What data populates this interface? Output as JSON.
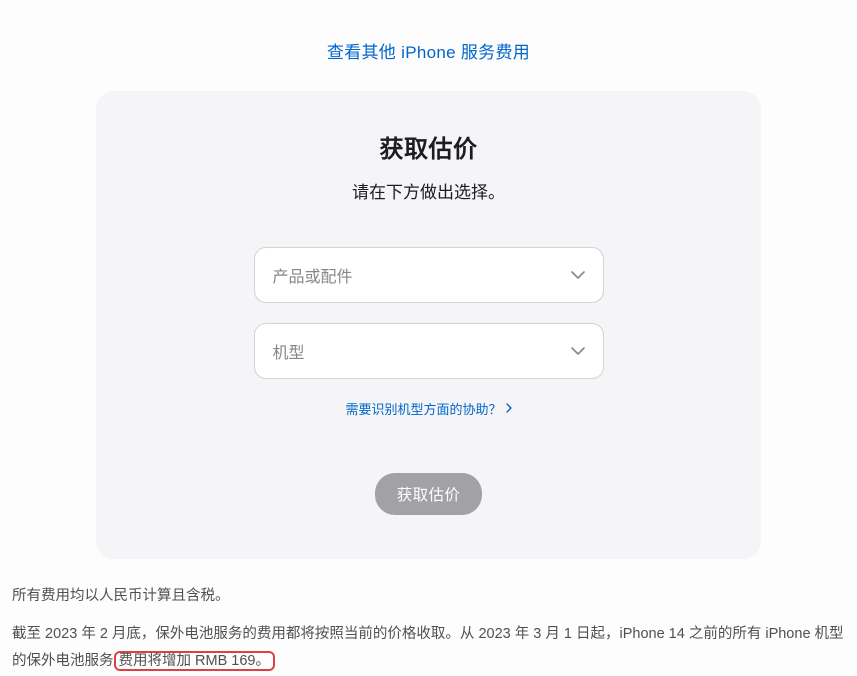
{
  "top_link": "查看其他 iPhone 服务费用",
  "card": {
    "title": "获取估价",
    "subtitle": "请在下方做出选择。",
    "dropdown1_placeholder": "产品或配件",
    "dropdown2_placeholder": "机型",
    "help_link": "需要识别机型方面的协助？",
    "submit_label": "获取估价"
  },
  "footnotes": {
    "line1": "所有费用均以人民币计算且含税。",
    "line2_part1": "截至 2023 年 2 月底，保外电池服务的费用都将按照当前的价格收取。从 2023 年 3 月 1 日起，iPhone 14 之前的所有 iPhone 机型的保外电池服务",
    "line2_highlight": "费用将增加 RMB 169。"
  }
}
